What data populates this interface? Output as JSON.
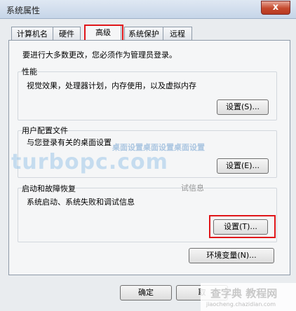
{
  "window": {
    "title": "系统属性",
    "close_glyph": "x"
  },
  "tabs": [
    {
      "label": "计算机名"
    },
    {
      "label": "硬件"
    },
    {
      "label": "高级"
    },
    {
      "label": "系统保护"
    },
    {
      "label": "远程"
    }
  ],
  "active_tab": "高级",
  "admin_note": "要进行大多数更改，您必须作为管理员登录。",
  "performance": {
    "title": "性能",
    "description": "视觉效果，处理器计划，内存使用，以及虚拟内存",
    "button": "设置(S)..."
  },
  "user_profiles": {
    "title": "用户配置文件",
    "description": "与您登录有关的桌面设置",
    "button": "设置(E)..."
  },
  "startup_recovery": {
    "title": "启动和故障恢复",
    "description": "系统启动、系统失败和调试信息",
    "button": "设置(T)..."
  },
  "env_button": "环境变量(N)...",
  "footer": {
    "ok": "确定",
    "cancel": "取"
  },
  "watermark": {
    "line1": "桌面设置桌面设置桌面设置",
    "line2": "turbopc.com",
    "line3": "试信息",
    "site_name": "查字典 教程网",
    "site_url": "jiaocheng.chazidian.com"
  },
  "colors": {
    "highlight": "#e0161a",
    "close_button": "#c5492d"
  }
}
